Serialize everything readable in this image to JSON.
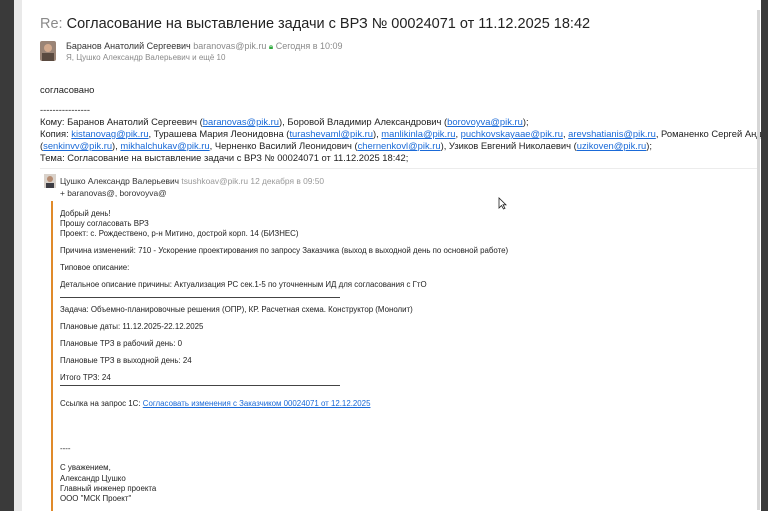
{
  "email": {
    "subject_prefix": "Re:",
    "subject": "Согласование на выставление задачи с ВРЗ № 00024071 от 11.12.2025 18:42",
    "sender_name": "Баранов Анатолий Сергеевич",
    "sender_email": "baranovas@pik.ru",
    "sent_time": "Сегодня в 10:09",
    "recipients_summary": "Я, Цушко Александр Валерьевич и ещё 10",
    "reply_text": "согласовано",
    "separator": "----------------",
    "to_label": "Кому:",
    "to_line_parts": {
      "p1": "Баранов Анатолий Сергеевич (",
      "l1": "baranovas@pik.ru",
      "p2": "), Боровой Владимир Александрович (",
      "l2": "borovoyva@pik.ru",
      "p3": ");"
    },
    "cc_label": "Копия:",
    "cc_line1_parts": {
      "l1": "kistanovag@pik.ru",
      "p1": ", Турашева Мария Леонидовна (",
      "l2": "turashevaml@pik.ru",
      "p2": "), ",
      "l3": "manlikinla@pik.ru",
      "p3": ", ",
      "l4": "puchkovskayaae@pik.ru",
      "p4": ", ",
      "l5": "arevshatianis@pik.ru",
      "p5": ", Романенко Сергей Андреевич (",
      "l6": "romano"
    },
    "cc_line2_parts": {
      "p0": "(",
      "l1": "senkinvv@pik.ru",
      "p1": "), ",
      "l2": "mikhalchukav@pik.ru",
      "p2": ", Черненко Василий Леонидович (",
      "l3": "chernenkovl@pik.ru",
      "p3": "), Узиков Евгений Николаевич (",
      "l4": "uzikoven@pik.ru",
      "p4": ");"
    },
    "theme_line": "Тема: Согласование на выставление задачи с ВРЗ № 00024071 от 11.12.2025 18:42;"
  },
  "quoted": {
    "sender_name": "Цушко Александр Валерьевич",
    "sender_email": "tsushkoav@pik.ru",
    "sent_time": "12 декабря в 09:50",
    "added": "+ baranovas@, borovoyva@",
    "greeting": "Добрый день!",
    "request": "Прошу согласовать ВРЗ",
    "project": "Проект: с. Рождествено, р-н Митино, дострой корп. 14 (БИЗНЕС)",
    "reason": "Причина изменений: 710 - Ускорение проектирования по запросу Заказчика (выход в выходной день по основной работе)",
    "typical": "Типовое описание:",
    "detailed": "Детальное описание причины: Актуализация РС сек.1-5 по уточненным ИД для согласования с ГтО",
    "task": "Задача: Объемно-планировочные решения (ОПР), КР. Расчетная схема. Конструктор (Монолит)",
    "planned_dates": "Плановые даты: 11.12.2025-22.12.2025",
    "trz_workday": "Плановые ТРЗ в рабочий день: 0",
    "trz_weekend": "Плановые ТРЗ в выходной день: 24",
    "trz_total": "Итого ТРЗ: 24",
    "link_label": "Ссылка на запрос 1С:",
    "link_text": "Согласовать изменения с Заказчиком 00024071 от 12.12.2025",
    "sig_separator": "----",
    "sig_regards": "С уважением,",
    "sig_name": "Александр Цушко",
    "sig_title": "Главный инженер проекта",
    "sig_company": "ООО \"МСК Проект\""
  },
  "colors": {
    "link": "#1a6ad8",
    "quote_bar": "#e08a2a",
    "verified": "#2eaa3c"
  }
}
